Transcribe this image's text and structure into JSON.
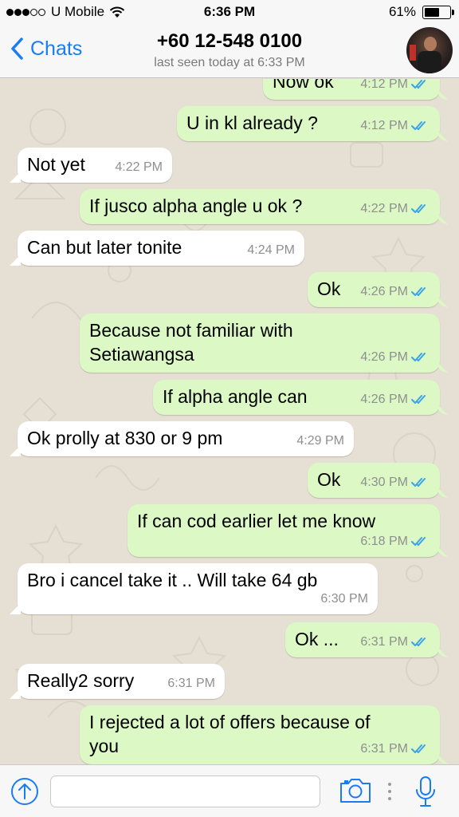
{
  "status_bar": {
    "carrier": "U Mobile",
    "time": "6:36 PM",
    "battery": "61%",
    "battery_level": 0.61,
    "signal_bars_filled": 3,
    "signal_bars_total": 5
  },
  "header": {
    "back_label": "Chats",
    "contact_name": "+60 12-548 0100",
    "last_seen": "last seen today at 6:33 PM"
  },
  "messages": [
    {
      "direction": "out",
      "text": "Now ok",
      "time": "4:12 PM",
      "read": true
    },
    {
      "direction": "out",
      "text": "U in kl already ?",
      "time": "4:12 PM",
      "read": true
    },
    {
      "direction": "in",
      "text": "Not yet",
      "time": "4:22 PM"
    },
    {
      "direction": "out",
      "text": "If jusco alpha angle u ok ?",
      "time": "4:22 PM",
      "read": true
    },
    {
      "direction": "in",
      "text": "Can but later tonite",
      "time": "4:24 PM"
    },
    {
      "direction": "out",
      "text": "Ok",
      "time": "4:26 PM",
      "read": true
    },
    {
      "direction": "out",
      "text": "Because not familiar with\nSetiawangsa",
      "time": "4:26 PM",
      "read": true
    },
    {
      "direction": "out",
      "text": "If alpha angle can",
      "time": "4:26 PM",
      "read": true
    },
    {
      "direction": "in",
      "text": "Ok prolly at 830 or 9 pm",
      "time": "4:29 PM"
    },
    {
      "direction": "out",
      "text": "Ok",
      "time": "4:30 PM",
      "read": true
    },
    {
      "direction": "out",
      "text": "If can cod earlier let me know",
      "time": "6:18 PM",
      "read": true
    },
    {
      "direction": "in",
      "text": "Bro i cancel take it .. Will take 64 gb",
      "time": "6:30 PM"
    },
    {
      "direction": "out",
      "text": "Ok ...",
      "time": "6:31 PM",
      "read": true
    },
    {
      "direction": "in",
      "text": "Really2 sorry",
      "time": "6:31 PM"
    },
    {
      "direction": "out",
      "text": "I rejected a lot of offers because of\nyou",
      "time": "6:31 PM",
      "read": true
    }
  ],
  "input_bar": {
    "placeholder": "",
    "icons": [
      "share-icon",
      "camera-icon",
      "mic-icon"
    ]
  },
  "colors": {
    "accent": "#1a7cf5",
    "outgoing_bubble": "#dbf8c5",
    "incoming_bubble": "#ffffff",
    "read_ticks": "#3aa3e8",
    "chat_background": "#e6dfd3"
  }
}
